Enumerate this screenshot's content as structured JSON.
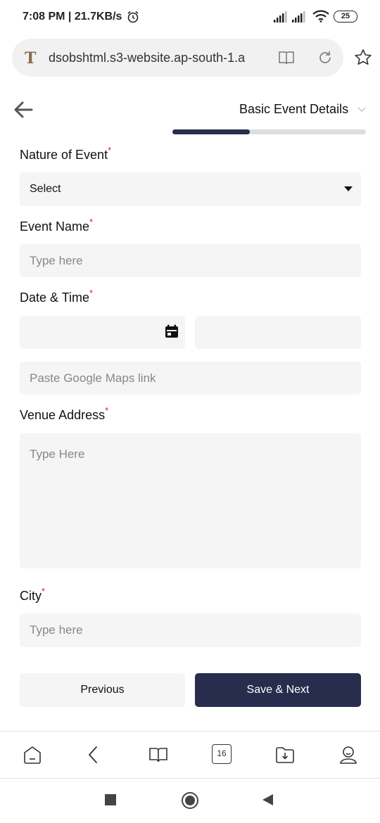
{
  "status_bar": {
    "time": "7:08 PM | 21.7KB/s",
    "battery": "25"
  },
  "browser": {
    "url": "dsobshtml.s3-website.ap-south-1.a",
    "favicon_letter": "T"
  },
  "header": {
    "step_title": "Basic Event Details",
    "progress_fraction": 0.4
  },
  "form": {
    "nature": {
      "label": "Nature of Event",
      "required": "*",
      "value": "Select"
    },
    "event_name": {
      "label": "Event Name",
      "required": "*",
      "placeholder": "Type here"
    },
    "date_time": {
      "label": "Date & Time",
      "required": "*"
    },
    "maps_link": {
      "placeholder": "Paste Google Maps link"
    },
    "venue": {
      "label": "Venue Address",
      "required": "*",
      "placeholder": "Type Here"
    },
    "city": {
      "label": "City",
      "required": "*",
      "placeholder": "Type here"
    }
  },
  "buttons": {
    "previous": "Previous",
    "save_next": "Save & Next"
  },
  "bottom_nav": {
    "tabs_count": "16",
    "icons": [
      "home-icon",
      "back-icon",
      "reader-icon",
      "tabs-icon",
      "downloads-icon",
      "profile-icon"
    ]
  },
  "colors": {
    "primary": "#282d4e",
    "required": "#dd2222",
    "field_bg": "#f5f5f5"
  }
}
